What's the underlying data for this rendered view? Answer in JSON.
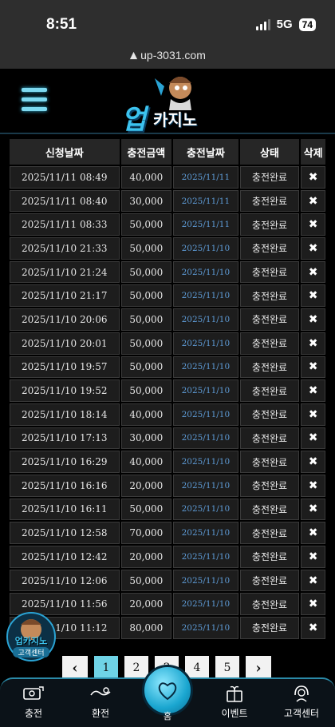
{
  "status_bar": {
    "time": "8:51",
    "network": "5G",
    "battery": "74"
  },
  "browser": {
    "url": "up-3031.com"
  },
  "table": {
    "headers": [
      "신청날짜",
      "충전금액",
      "충전날짜",
      "상태",
      "삭제"
    ],
    "rows": [
      {
        "requested": "2025/11/11 08:49",
        "amount": "40,000",
        "charged": "2025/11/11",
        "status": "충전완료",
        "delete": "✖"
      },
      {
        "requested": "2025/11/11 08:40",
        "amount": "30,000",
        "charged": "2025/11/11",
        "status": "충전완료",
        "delete": "✖"
      },
      {
        "requested": "2025/11/11 08:33",
        "amount": "50,000",
        "charged": "2025/11/11",
        "status": "충전완료",
        "delete": "✖"
      },
      {
        "requested": "2025/11/10 21:33",
        "amount": "50,000",
        "charged": "2025/11/10",
        "status": "충전완료",
        "delete": "✖"
      },
      {
        "requested": "2025/11/10 21:24",
        "amount": "50,000",
        "charged": "2025/11/10",
        "status": "충전완료",
        "delete": "✖"
      },
      {
        "requested": "2025/11/10 21:17",
        "amount": "50,000",
        "charged": "2025/11/10",
        "status": "충전완료",
        "delete": "✖"
      },
      {
        "requested": "2025/11/10 20:06",
        "amount": "50,000",
        "charged": "2025/11/10",
        "status": "충전완료",
        "delete": "✖"
      },
      {
        "requested": "2025/11/10 20:01",
        "amount": "50,000",
        "charged": "2025/11/10",
        "status": "충전완료",
        "delete": "✖"
      },
      {
        "requested": "2025/11/10 19:57",
        "amount": "50,000",
        "charged": "2025/11/10",
        "status": "충전완료",
        "delete": "✖"
      },
      {
        "requested": "2025/11/10 19:52",
        "amount": "50,000",
        "charged": "2025/11/10",
        "status": "충전완료",
        "delete": "✖"
      },
      {
        "requested": "2025/11/10 18:14",
        "amount": "40,000",
        "charged": "2025/11/10",
        "status": "충전완료",
        "delete": "✖"
      },
      {
        "requested": "2025/11/10 17:13",
        "amount": "30,000",
        "charged": "2025/11/10",
        "status": "충전완료",
        "delete": "✖"
      },
      {
        "requested": "2025/11/10 16:29",
        "amount": "40,000",
        "charged": "2025/11/10",
        "status": "충전완료",
        "delete": "✖"
      },
      {
        "requested": "2025/11/10 16:16",
        "amount": "20,000",
        "charged": "2025/11/10",
        "status": "충전완료",
        "delete": "✖"
      },
      {
        "requested": "2025/11/10 16:11",
        "amount": "50,000",
        "charged": "2025/11/10",
        "status": "충전완료",
        "delete": "✖"
      },
      {
        "requested": "2025/11/10 12:58",
        "amount": "70,000",
        "charged": "2025/11/10",
        "status": "충전완료",
        "delete": "✖"
      },
      {
        "requested": "2025/11/10 12:42",
        "amount": "20,000",
        "charged": "2025/11/10",
        "status": "충전완료",
        "delete": "✖"
      },
      {
        "requested": "2025/11/10 12:06",
        "amount": "50,000",
        "charged": "2025/11/10",
        "status": "충전완료",
        "delete": "✖"
      },
      {
        "requested": "2025/11/10 11:56",
        "amount": "20,000",
        "charged": "2025/11/10",
        "status": "충전완료",
        "delete": "✖"
      },
      {
        "requested": "2025/11/10 11:12",
        "amount": "80,000",
        "charged": "2025/11/10",
        "status": "충전완료",
        "delete": "✖"
      }
    ]
  },
  "pagination": {
    "prev": "‹",
    "pages": [
      "1",
      "2",
      "3",
      "4",
      "5"
    ],
    "active_page": "1",
    "next": "›"
  },
  "logo": {
    "text_main": "업",
    "text_sub": "카지노"
  },
  "float_badge": {
    "title": "업카지노",
    "subtitle": "고객센터"
  },
  "bottom_nav": {
    "items": [
      {
        "label": "충전",
        "icon": "deposit-icon"
      },
      {
        "label": "환전",
        "icon": "withdraw-icon"
      },
      {
        "label": "홈",
        "icon": "heart-home-icon"
      },
      {
        "label": "이벤트",
        "icon": "gift-icon"
      },
      {
        "label": "고객센터",
        "icon": "headset-icon"
      }
    ]
  },
  "colors": {
    "accent": "#6fd3e6",
    "date_link": "#5e9bd6",
    "background": "#000000"
  }
}
